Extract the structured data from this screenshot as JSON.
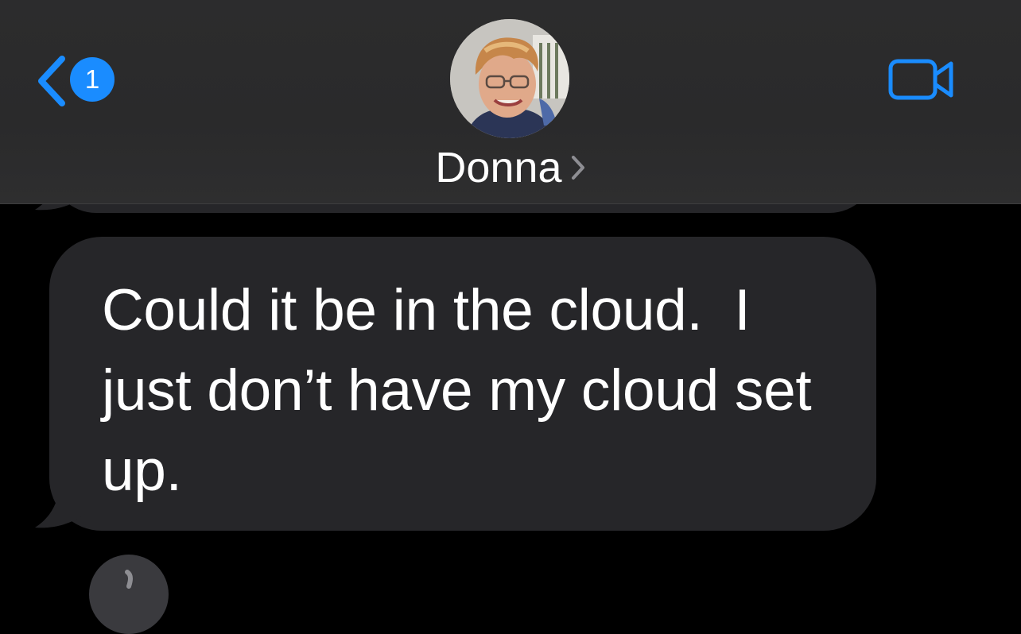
{
  "header": {
    "back_badge_count": "1",
    "contact_name": "Donna",
    "back_icon": "chevron-left-icon",
    "video_icon": "video-camera-icon",
    "disclosure_icon": "chevron-right-icon"
  },
  "conversation": {
    "messages": [
      {
        "direction": "received",
        "text": "Could it be in the cloud.  I just don’t have my cloud set up."
      }
    ]
  },
  "colors": {
    "accent": "#1a8cff",
    "header_bg": "#2c2c2d",
    "received_bubble": "#262629",
    "background": "#000000",
    "text": "#ffffff"
  }
}
